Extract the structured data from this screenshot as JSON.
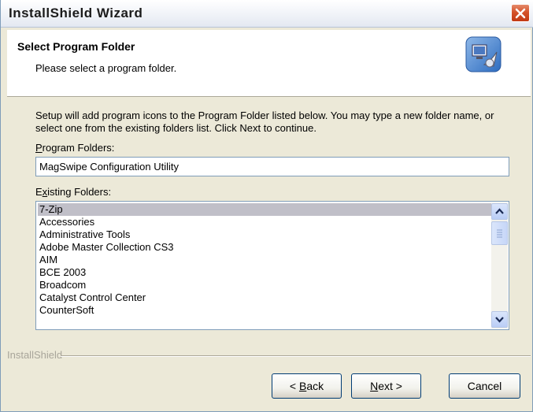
{
  "window": {
    "title": "InstallShield Wizard"
  },
  "header": {
    "title": "Select Program Folder",
    "subtitle": "Please select a program folder."
  },
  "body": {
    "intro": "Setup will add program icons to the Program Folder listed below.  You may type a new folder name, or select one from the existing folders list.  Click Next to continue.",
    "program_folders_label": "Program Folders:",
    "program_folder_value": "MagSwipe Configuration Utility",
    "existing_folders_label": "Existing Folders:",
    "existing_folders": [
      "7-Zip",
      "Accessories",
      "Administrative Tools",
      "Adobe Master Collection CS3",
      "AIM",
      "BCE 2003",
      "Broadcom",
      "Catalyst Control Center",
      "CounterSoft"
    ],
    "selected_folder": "7-Zip"
  },
  "footer": {
    "brand": "InstallShield",
    "back_label": "< Back",
    "next_label": "Next >",
    "cancel_label": "Cancel"
  },
  "icons": {
    "close": "close-icon",
    "header": "computer-setup-icon",
    "scroll_up": "scroll-up-icon",
    "scroll_down": "scroll-down-icon"
  }
}
